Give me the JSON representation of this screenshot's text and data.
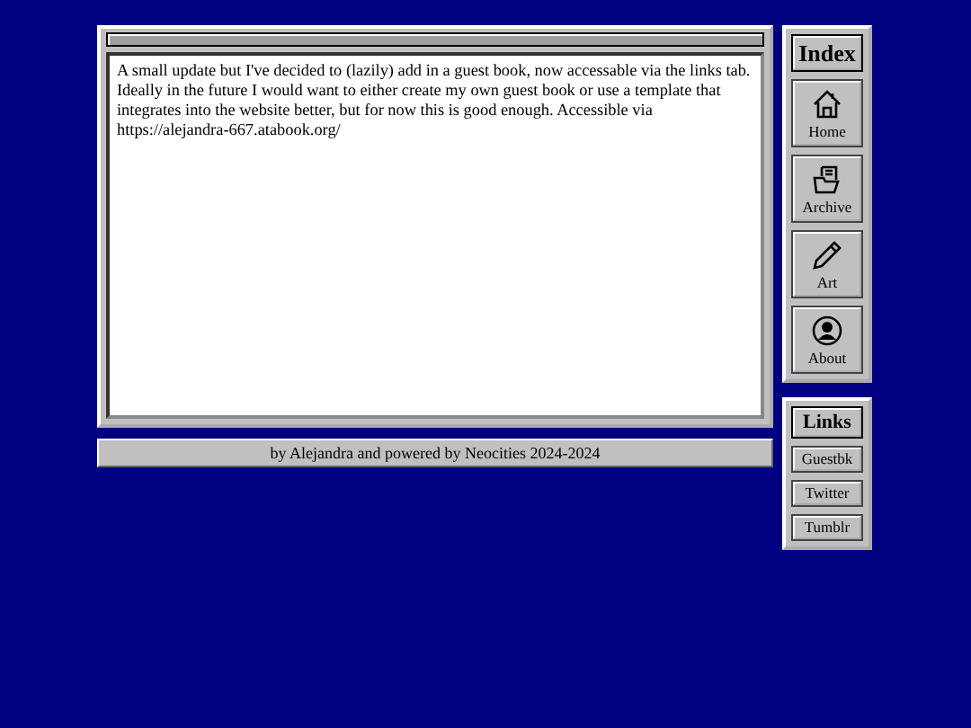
{
  "post": {
    "text": "A small update but I've decided to (lazily) add in a guest book, now accessable via the links tab. Ideally in the future I would want to either create my own guest book or use a template that integrates into the website better, but for now this is good enough. Accessible via https://alejandra-667.atabook.org/"
  },
  "footer": "by Alejandra and powered by Neocities 2024-2024",
  "index": {
    "title": "Index",
    "items": [
      {
        "label": "Home"
      },
      {
        "label": "Archive"
      },
      {
        "label": "Art"
      },
      {
        "label": "About"
      }
    ]
  },
  "links": {
    "title": "Links",
    "items": [
      "Guestbk",
      "Twitter",
      "Tumblr"
    ]
  }
}
